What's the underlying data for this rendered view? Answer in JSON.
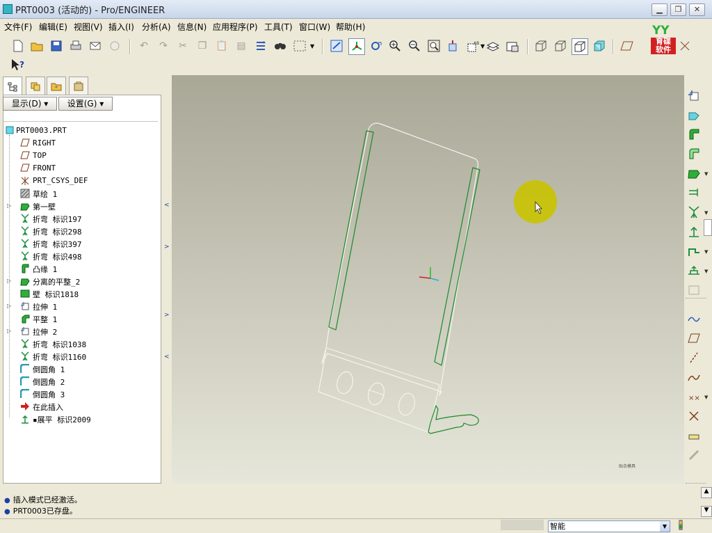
{
  "window": {
    "title": "PRT0003 (活动的) - Pro/ENGINEER",
    "min_label": "▁",
    "max_label": "❐",
    "close_label": "✕"
  },
  "menu": [
    "文件(F)",
    "编辑(E)",
    "视图(V)",
    "插入(I)",
    "分析(A)",
    "信息(N)",
    "应用程序(P)",
    "工具(T)",
    "窗口(W)",
    "帮助(H)"
  ],
  "logo": {
    "text": "育碟\n软件",
    "mark": "YY"
  },
  "model_tree": {
    "display_button": "显示(D)",
    "settings_button": "设置(G)",
    "root": "PRT0003.PRT",
    "items": [
      {
        "label": "RIGHT",
        "icon": "datum-plane-icon",
        "expandable": false
      },
      {
        "label": "TOP",
        "icon": "datum-plane-icon",
        "expandable": false
      },
      {
        "label": "FRONT",
        "icon": "datum-plane-icon",
        "expandable": false
      },
      {
        "label": "PRT_CSYS_DEF",
        "icon": "csys-icon",
        "expandable": false
      },
      {
        "label": "草绘 1",
        "icon": "sketch-icon",
        "expandable": false
      },
      {
        "label": "第一壁",
        "icon": "first-wall-icon",
        "expandable": true
      },
      {
        "label": "折弯 标识197",
        "icon": "bend-icon",
        "expandable": false
      },
      {
        "label": "折弯 标识298",
        "icon": "bend-icon",
        "expandable": false
      },
      {
        "label": "折弯 标识397",
        "icon": "bend-icon",
        "expandable": false
      },
      {
        "label": "折弯 标识498",
        "icon": "bend-icon",
        "expandable": false
      },
      {
        "label": "凸缘 1",
        "icon": "flange-icon",
        "expandable": false
      },
      {
        "label": "分离的平整_2",
        "icon": "unattached-flat-icon",
        "expandable": true
      },
      {
        "label": "壁 标识1818",
        "icon": "wall-icon",
        "expandable": false
      },
      {
        "label": "拉伸 1",
        "icon": "extrude-icon",
        "expandable": true
      },
      {
        "label": "平整 1",
        "icon": "flat-icon",
        "expandable": false
      },
      {
        "label": "拉伸 2",
        "icon": "extrude-icon",
        "expandable": true
      },
      {
        "label": "折弯 标识1038",
        "icon": "bend-icon",
        "expandable": false
      },
      {
        "label": "折弯 标识1160",
        "icon": "bend-icon",
        "expandable": false
      },
      {
        "label": "倒圆角 1",
        "icon": "round-icon",
        "expandable": false
      },
      {
        "label": "倒圆角 2",
        "icon": "round-icon",
        "expandable": false
      },
      {
        "label": "倒圆角 3",
        "icon": "round-icon",
        "expandable": false
      },
      {
        "label": "在此插入",
        "icon": "insert-here-arrow-icon",
        "expandable": false
      },
      {
        "label": "▪展平 标识2009",
        "icon": "unbend-icon",
        "expandable": false
      }
    ]
  },
  "messages": [
    "插入模式已经激活。",
    "PRT0003已存盘。"
  ],
  "status": {
    "filter_value": "智能"
  },
  "viewport": {
    "small_label": "贴合模具"
  },
  "colors": {
    "edge_green": "#1a8a2a",
    "edge_white": "#f4f4ee",
    "viewport_top": "#a9a796",
    "viewport_bottom": "#e6e6da",
    "cursor_highlight": "#c9c300"
  }
}
